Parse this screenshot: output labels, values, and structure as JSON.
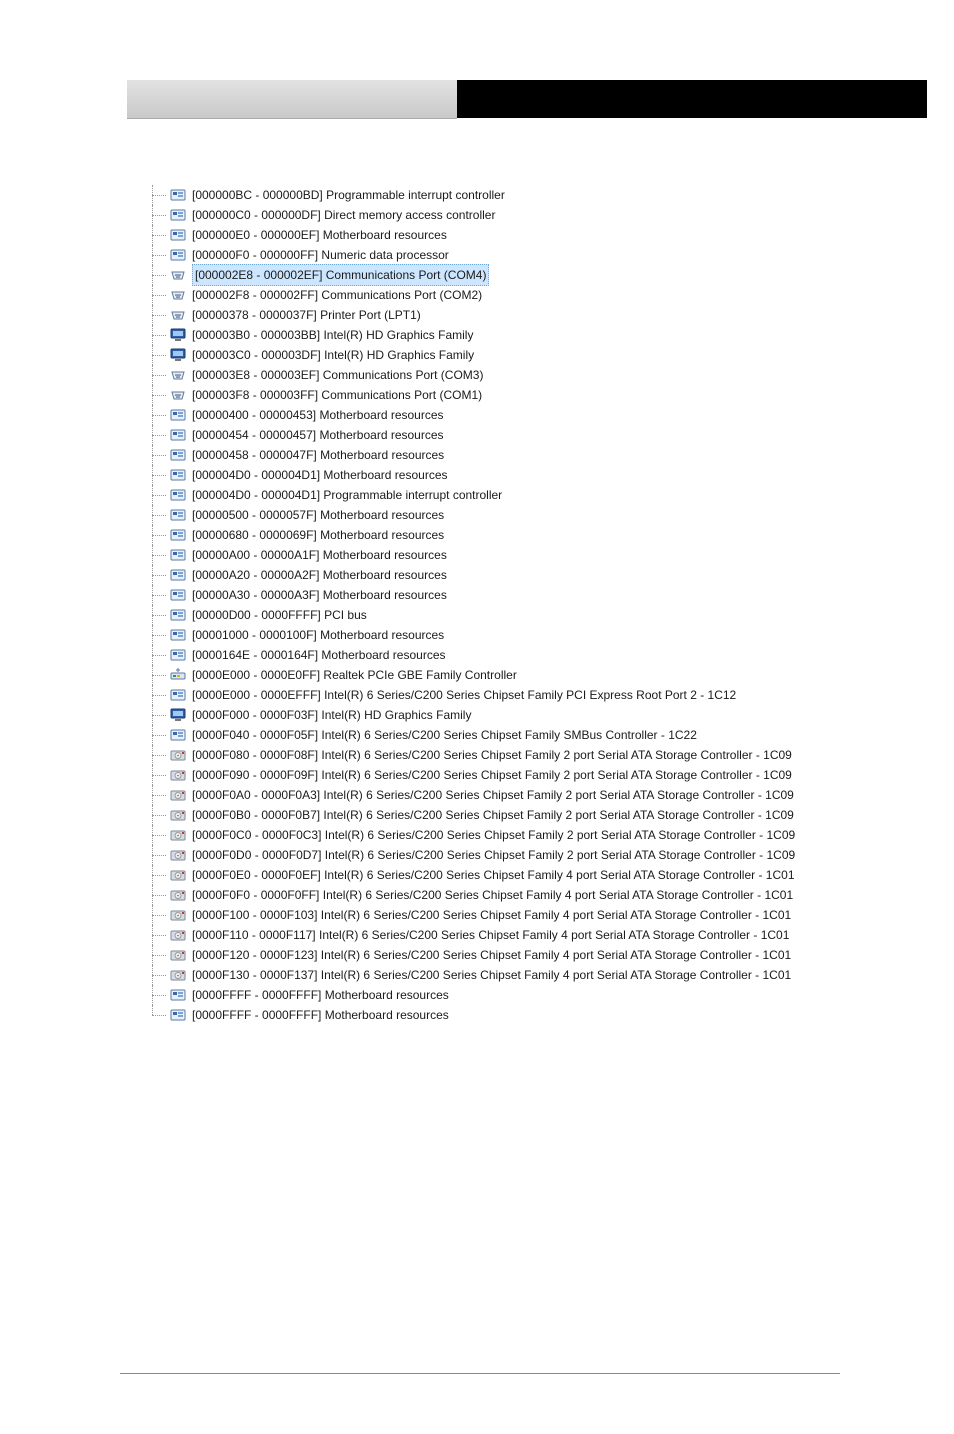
{
  "icons": {
    "system": "system-resource-icon",
    "display": "display-adapter-icon",
    "port": "com-port-icon",
    "net": "network-adapter-icon",
    "storage": "storage-controller-icon"
  },
  "tree": {
    "items": [
      {
        "icon": "system",
        "range": "[000000BC - 000000BD]",
        "desc": "Programmable interrupt controller"
      },
      {
        "icon": "system",
        "range": "[000000C0 - 000000DF]",
        "desc": "Direct memory access controller"
      },
      {
        "icon": "system",
        "range": "[000000E0 - 000000EF]",
        "desc": "Motherboard resources"
      },
      {
        "icon": "system",
        "range": "[000000F0 - 000000FF]",
        "desc": "Numeric data processor"
      },
      {
        "icon": "port",
        "range": "[000002E8 - 000002EF]",
        "desc": "Communications Port (COM4)",
        "selected": true
      },
      {
        "icon": "port",
        "range": "[000002F8 - 000002FF]",
        "desc": "Communications Port (COM2)"
      },
      {
        "icon": "port",
        "range": "[00000378 - 0000037F]",
        "desc": "Printer Port (LPT1)"
      },
      {
        "icon": "display",
        "range": "[000003B0 - 000003BB]",
        "desc": "Intel(R) HD Graphics Family"
      },
      {
        "icon": "display",
        "range": "[000003C0 - 000003DF]",
        "desc": "Intel(R) HD Graphics Family"
      },
      {
        "icon": "port",
        "range": "[000003E8 - 000003EF]",
        "desc": "Communications Port (COM3)"
      },
      {
        "icon": "port",
        "range": "[000003F8 - 000003FF]",
        "desc": "Communications Port (COM1)"
      },
      {
        "icon": "system",
        "range": "[00000400 - 00000453]",
        "desc": "Motherboard resources"
      },
      {
        "icon": "system",
        "range": "[00000454 - 00000457]",
        "desc": "Motherboard resources"
      },
      {
        "icon": "system",
        "range": "[00000458 - 0000047F]",
        "desc": "Motherboard resources"
      },
      {
        "icon": "system",
        "range": "[000004D0 - 000004D1]",
        "desc": "Motherboard resources"
      },
      {
        "icon": "system",
        "range": "[000004D0 - 000004D1]",
        "desc": "Programmable interrupt controller"
      },
      {
        "icon": "system",
        "range": "[00000500 - 0000057F]",
        "desc": "Motherboard resources"
      },
      {
        "icon": "system",
        "range": "[00000680 - 0000069F]",
        "desc": "Motherboard resources"
      },
      {
        "icon": "system",
        "range": "[00000A00 - 00000A1F]",
        "desc": "Motherboard resources"
      },
      {
        "icon": "system",
        "range": "[00000A20 - 00000A2F]",
        "desc": "Motherboard resources"
      },
      {
        "icon": "system",
        "range": "[00000A30 - 00000A3F]",
        "desc": "Motherboard resources"
      },
      {
        "icon": "system",
        "range": "[00000D00 - 0000FFFF]",
        "desc": "PCI bus"
      },
      {
        "icon": "system",
        "range": "[00001000 - 0000100F]",
        "desc": "Motherboard resources"
      },
      {
        "icon": "system",
        "range": "[0000164E - 0000164F]",
        "desc": "Motherboard resources"
      },
      {
        "icon": "net",
        "range": "[0000E000 - 0000E0FF]",
        "desc": "Realtek PCIe GBE Family Controller"
      },
      {
        "icon": "system",
        "range": "[0000E000 - 0000EFFF]",
        "desc": "Intel(R) 6 Series/C200 Series Chipset Family PCI Express Root Port 2 - 1C12"
      },
      {
        "icon": "display",
        "range": "[0000F000 - 0000F03F]",
        "desc": "Intel(R) HD Graphics Family"
      },
      {
        "icon": "system",
        "range": "[0000F040 - 0000F05F]",
        "desc": "Intel(R) 6 Series/C200 Series Chipset Family SMBus Controller - 1C22"
      },
      {
        "icon": "storage",
        "range": "[0000F080 - 0000F08F]",
        "desc": "Intel(R) 6 Series/C200 Series Chipset Family 2 port Serial ATA Storage Controller - 1C09"
      },
      {
        "icon": "storage",
        "range": "[0000F090 - 0000F09F]",
        "desc": "Intel(R) 6 Series/C200 Series Chipset Family 2 port Serial ATA Storage Controller - 1C09"
      },
      {
        "icon": "storage",
        "range": "[0000F0A0 - 0000F0A3]",
        "desc": "Intel(R) 6 Series/C200 Series Chipset Family 2 port Serial ATA Storage Controller - 1C09"
      },
      {
        "icon": "storage",
        "range": "[0000F0B0 - 0000F0B7]",
        "desc": "Intel(R) 6 Series/C200 Series Chipset Family 2 port Serial ATA Storage Controller - 1C09"
      },
      {
        "icon": "storage",
        "range": "[0000F0C0 - 0000F0C3]",
        "desc": "Intel(R) 6 Series/C200 Series Chipset Family 2 port Serial ATA Storage Controller - 1C09"
      },
      {
        "icon": "storage",
        "range": "[0000F0D0 - 0000F0D7]",
        "desc": "Intel(R) 6 Series/C200 Series Chipset Family 2 port Serial ATA Storage Controller - 1C09"
      },
      {
        "icon": "storage",
        "range": "[0000F0E0 - 0000F0EF]",
        "desc": "Intel(R) 6 Series/C200 Series Chipset Family 4 port Serial ATA Storage Controller - 1C01"
      },
      {
        "icon": "storage",
        "range": "[0000F0F0 - 0000F0FF]",
        "desc": "Intel(R) 6 Series/C200 Series Chipset Family 4 port Serial ATA Storage Controller - 1C01"
      },
      {
        "icon": "storage",
        "range": "[0000F100 - 0000F103]",
        "desc": "Intel(R) 6 Series/C200 Series Chipset Family 4 port Serial ATA Storage Controller - 1C01"
      },
      {
        "icon": "storage",
        "range": "[0000F110 - 0000F117]",
        "desc": "Intel(R) 6 Series/C200 Series Chipset Family 4 port Serial ATA Storage Controller - 1C01"
      },
      {
        "icon": "storage",
        "range": "[0000F120 - 0000F123]",
        "desc": "Intel(R) 6 Series/C200 Series Chipset Family 4 port Serial ATA Storage Controller - 1C01"
      },
      {
        "icon": "storage",
        "range": "[0000F130 - 0000F137]",
        "desc": "Intel(R) 6 Series/C200 Series Chipset Family 4 port Serial ATA Storage Controller - 1C01"
      },
      {
        "icon": "system",
        "range": "[0000FFFF - 0000FFFF]",
        "desc": "Motherboard resources"
      },
      {
        "icon": "system",
        "range": "[0000FFFF - 0000FFFF]",
        "desc": "Motherboard resources",
        "last": true
      }
    ]
  }
}
